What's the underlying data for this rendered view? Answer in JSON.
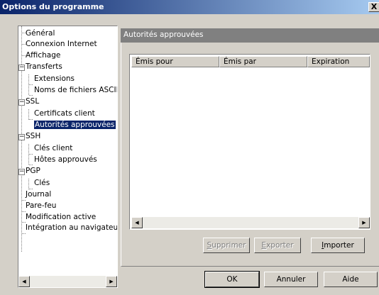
{
  "window": {
    "title": "Options du programme",
    "close_label": "X"
  },
  "tree": {
    "items": [
      {
        "label": "Général"
      },
      {
        "label": "Connexion Internet"
      },
      {
        "label": "Affichage"
      },
      {
        "label": "Transferts",
        "expander": "−"
      },
      {
        "label": "Extensions"
      },
      {
        "label": "Noms de fichiers ASCII"
      },
      {
        "label": "SSL",
        "expander": "−"
      },
      {
        "label": "Certificats client"
      },
      {
        "label": "Autorités approuvées",
        "selected": true
      },
      {
        "label": "SSH",
        "expander": "−"
      },
      {
        "label": "Clés client"
      },
      {
        "label": "Hôtes approuvés"
      },
      {
        "label": "PGP",
        "expander": "−"
      },
      {
        "label": "Clés"
      },
      {
        "label": "Journal"
      },
      {
        "label": "Pare-feu"
      },
      {
        "label": "Modification active"
      },
      {
        "label": "Intégration au navigateur"
      }
    ],
    "scroll_left": "◀",
    "scroll_right": "▶"
  },
  "panel": {
    "title": "Autorités approuvées",
    "list": {
      "columns": [
        "Émis pour",
        "Émis par",
        "Expiration"
      ],
      "rows": [],
      "scroll_left": "◀",
      "scroll_right": "▶"
    },
    "buttons": {
      "delete": {
        "mnemonic": "S",
        "rest": "upprimer",
        "enabled": false
      },
      "export": {
        "mnemonic": "E",
        "rest": "xporter",
        "enabled": false
      },
      "import": {
        "mnemonic": "I",
        "rest": "mporter",
        "enabled": true
      }
    }
  },
  "footer": {
    "ok": "OK",
    "cancel": "Annuler",
    "help": "Aide"
  },
  "colors": {
    "title_start": "#0a246a",
    "title_end": "#a6caf0",
    "selection": "#0a246a",
    "face": "#d4d0c8",
    "header_gray": "#808080"
  }
}
